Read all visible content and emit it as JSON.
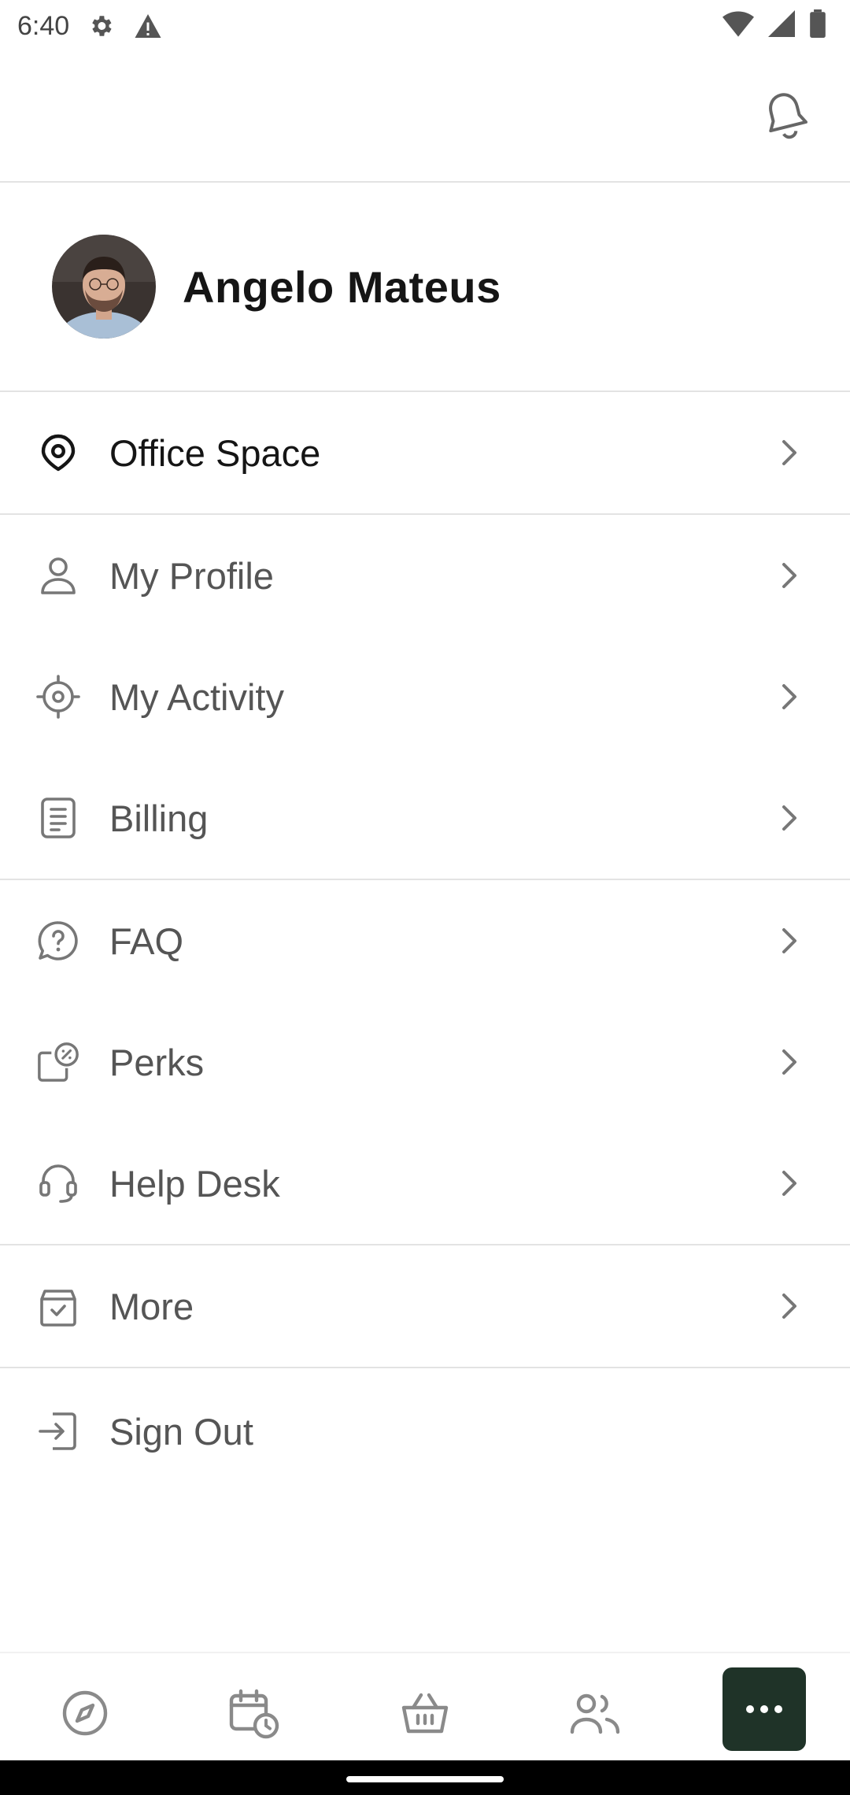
{
  "status_bar": {
    "time": "6:40",
    "left_icons": [
      "settings-gear-icon",
      "warning-icon"
    ],
    "right_icons": [
      "wifi-icon",
      "cellular-signal-icon",
      "battery-icon"
    ]
  },
  "header": {
    "notification_icon": "bell-icon"
  },
  "profile": {
    "name": "Angelo Mateus"
  },
  "menu": {
    "sections": [
      {
        "items": [
          {
            "label": "Office Space",
            "icon": "location-pin-icon"
          }
        ]
      },
      {
        "items": [
          {
            "label": "My Profile",
            "icon": "person-icon"
          },
          {
            "label": "My Activity",
            "icon": "target-icon"
          },
          {
            "label": "Billing",
            "icon": "document-icon"
          }
        ]
      },
      {
        "items": [
          {
            "label": "FAQ",
            "icon": "question-chat-icon"
          },
          {
            "label": "Perks",
            "icon": "perks-discount-icon"
          },
          {
            "label": "Help Desk",
            "icon": "headset-icon"
          }
        ]
      },
      {
        "items": [
          {
            "label": "More",
            "icon": "box-check-icon"
          }
        ]
      },
      {
        "items": [
          {
            "label": "Sign Out",
            "icon": "sign-out-icon"
          }
        ]
      }
    ]
  },
  "bottom_nav": {
    "items": [
      "compass-icon",
      "calendar-clock-icon",
      "basket-icon",
      "people-icon",
      "more-dots-icon"
    ],
    "active": "more-dots-icon",
    "active_color": "#1f3328"
  }
}
